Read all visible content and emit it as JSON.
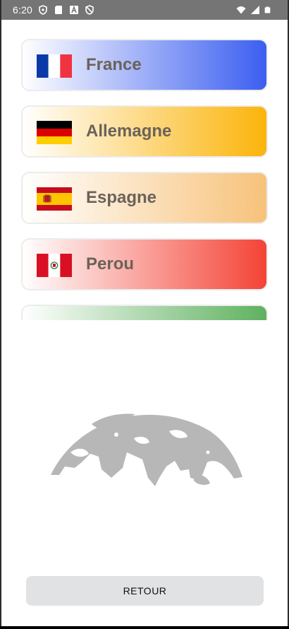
{
  "status_bar": {
    "time": "6:20",
    "left_icons": [
      "shield-icon",
      "sd-card-icon",
      "text-a-icon",
      "shield-icon"
    ],
    "right_icons": [
      "wifi-icon",
      "signal-icon",
      "battery-icon"
    ]
  },
  "countries": [
    {
      "name": "France",
      "flag": "france-flag-icon",
      "gradient_color": "#3b5ef0"
    },
    {
      "name": "Allemagne",
      "flag": "germany-flag-icon",
      "gradient_color": "#fbb40a"
    },
    {
      "name": "Espagne",
      "flag": "spain-flag-icon",
      "gradient_color": "#f7c27a"
    },
    {
      "name": "Perou",
      "flag": "peru-flag-icon",
      "gradient_color": "#f44336"
    },
    {
      "name": "",
      "flag": "",
      "gradient_color": "#5fb15f"
    }
  ],
  "illustration": "globe-icon",
  "back_button": {
    "label": "RETOUR"
  },
  "colors": {
    "status_bar": "#757575",
    "button_bg": "#e1e2e3",
    "text": "#6b625a",
    "globe": "#b7b7b7"
  }
}
